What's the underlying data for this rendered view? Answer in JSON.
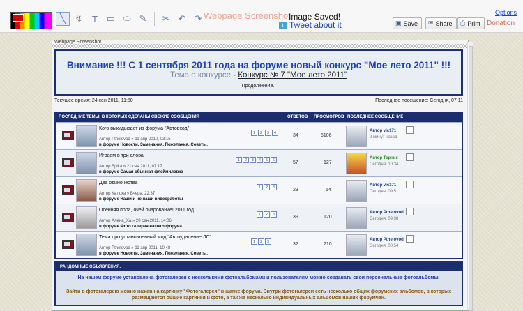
{
  "toolbar": {
    "watermark": "Webpage Screenshot",
    "status": "Image Saved!",
    "tweet": "Tweet about it",
    "save": "Save",
    "share": "Share",
    "print": "Print",
    "options": "Options",
    "donation": "Donation"
  },
  "screenshot": {
    "title": "Webpage Screenshot",
    "announcement": {
      "heading": "Внимание !!! С 1 сентября 2011 года на форуме новый конкурс \"Мое лето 2011\" !!!",
      "sub_prefix": "Тема о конкурсе - ",
      "sub_link": "Конкурс № 7 \"Мое лето 2011\"",
      "more": "Продолжение.."
    },
    "current_time": "Текущее время: 24 сен 2011, 11:50",
    "last_visit": "Последнее посещение: Сегодня, 07:11",
    "table": {
      "headers": {
        "topics": "ПОСЛЕДНИЕ ТЕМЫ, В КОТОРЫХ СДЕЛАНЫ СВЕЖИЕ СООБЩЕНИЯ",
        "replies": "ОТВЕТОВ",
        "views": "ПРОСМОТРОВ",
        "last": "ПОСЛЕДНЕЕ СООБЩЕНИЕ"
      },
      "rows": [
        {
          "title": "Кого выкидывает из форума \"Автовход\"",
          "author_line": "Автор Pthelovod » 11 апр 2010, 03:15",
          "forum_line": "в форуме Новости. Замечания. Пожелания. Советы.",
          "pages": [
            "1",
            "2",
            "3",
            "4"
          ],
          "replies": "34",
          "views": "5106",
          "last_author": "Автор vic171",
          "last_time": "9 минут назад"
        },
        {
          "title": "Играем в три слова.",
          "author_line": "Автор Spika » 21 сен 2011, 07:17",
          "forum_line": "в форуме Самая обычная флеймиловка",
          "pages": [
            "1",
            "2",
            "3",
            "4",
            "5",
            "6"
          ],
          "replies": "57",
          "views": "127",
          "last_author": "Автор Терник",
          "last_time": "Сегодня, 10:34"
        },
        {
          "title": "Два одиночества",
          "author_line": "Автор Катюха » Вчера, 22:37",
          "forum_line": "в форуме Наши и не наши видеоработы",
          "pages": [
            "1",
            "2",
            "3"
          ],
          "replies": "23",
          "views": "54",
          "last_author": "Автор vic171",
          "last_time": "Сегодня, 09:51"
        },
        {
          "title": "Осенняя пора, очей очарование! 2011 год",
          "author_line": "Автор Алена_Ха » 20 сен 2011, 14:06",
          "forum_line": "в форуме Фото галерея нашего форума",
          "pages": [
            "1",
            "2",
            "3"
          ],
          "replies": "39",
          "views": "120",
          "last_author": "Автор Pthelovod",
          "last_time": "Сегодня, 09:38"
        },
        {
          "title": "Тема про установленный мод \"Автоудаление ЛС\"",
          "author_line": "Автор Pthelovod » 11 апр 2011, 10:48",
          "forum_line": "в форуме Новости. Замечания. Пожелания. Советы.",
          "pages": [
            "1",
            "2",
            "3"
          ],
          "replies": "32",
          "views": "210",
          "last_author": "Автор Pthelovod",
          "last_time": "Сегодня, 08:54"
        }
      ]
    },
    "random": {
      "header": "РАНДОМНЫЕ ОБЪЯВЛЕНИЯ.",
      "p1": "На нашем форуме установлена фотогалерея с несколькими фотоальбомами и пользователям можно создавать свои персональные фотоальбомы.",
      "p2": "Зайти в фотогалерею можно нажав на картинку \"Фотогалерея\" в шапке форума. Внутри фотогалереи есть несколько общих форумских альбомов, в которых размещаются общие картинки и фото, а так же несколько индивидуальных альбомов наших форумчан."
    }
  }
}
